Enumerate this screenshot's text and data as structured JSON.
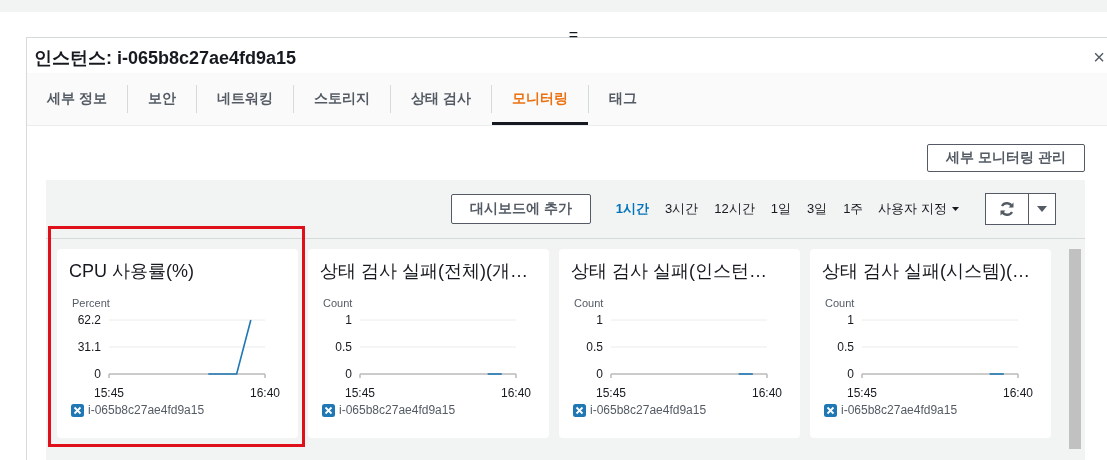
{
  "resize_handle": "=",
  "panel": {
    "title": "인스턴스: i-065b8c27ae4fd9a15",
    "close": "×"
  },
  "tabs": [
    {
      "label": "세부 정보",
      "selected": false
    },
    {
      "label": "보안",
      "selected": false
    },
    {
      "label": "네트워킹",
      "selected": false
    },
    {
      "label": "스토리지",
      "selected": false
    },
    {
      "label": "상태 검사",
      "selected": false
    },
    {
      "label": "모니터링",
      "selected": true
    },
    {
      "label": "태그",
      "selected": false
    }
  ],
  "manage_button": "세부 모니터링 관리",
  "toolbar": {
    "add_button": "대시보드에 추가",
    "time_ranges": [
      {
        "label": "1시간",
        "selected": true
      },
      {
        "label": "3시간",
        "selected": false
      },
      {
        "label": "12시간",
        "selected": false
      },
      {
        "label": "1일",
        "selected": false
      },
      {
        "label": "3일",
        "selected": false
      },
      {
        "label": "1주",
        "selected": false
      }
    ],
    "custom_range": "사용자 지정"
  },
  "charts": [
    {
      "highlighted": true,
      "chart_data": {
        "type": "line",
        "title": "CPU 사용률(%)",
        "ylabel": "Percent",
        "categories": [
          "15:45",
          null,
          null,
          null,
          null,
          null,
          null,
          null,
          null,
          null,
          null,
          "16:40"
        ],
        "series": [
          {
            "name": "i-065b8c27ae4fd9a15",
            "color": "#1f77b4",
            "values": [
              null,
              null,
              null,
              null,
              null,
              null,
              null,
              0,
              0,
              0,
              62.2,
              null
            ]
          }
        ],
        "ylim": [
          0,
          62.2
        ],
        "yticks": [
          0,
          31.1,
          62.2
        ]
      }
    },
    {
      "highlighted": false,
      "chart_data": {
        "type": "line",
        "title": "상태 검사 실패(전체)(개…",
        "ylabel": "Count",
        "categories": [
          "15:45",
          null,
          null,
          null,
          null,
          null,
          null,
          null,
          null,
          null,
          null,
          "16:40"
        ],
        "series": [
          {
            "name": "i-065b8c27ae4fd9a15",
            "color": "#1f77b4",
            "values": [
              null,
              null,
              null,
              null,
              null,
              null,
              null,
              null,
              null,
              0,
              0,
              null
            ]
          }
        ],
        "ylim": [
          0,
          1
        ],
        "yticks": [
          0,
          0.5,
          1
        ]
      }
    },
    {
      "highlighted": false,
      "chart_data": {
        "type": "line",
        "title": "상태 검사 실패(인스턴…",
        "ylabel": "Count",
        "categories": [
          "15:45",
          null,
          null,
          null,
          null,
          null,
          null,
          null,
          null,
          null,
          null,
          "16:40"
        ],
        "series": [
          {
            "name": "i-065b8c27ae4fd9a15",
            "color": "#1f77b4",
            "values": [
              null,
              null,
              null,
              null,
              null,
              null,
              null,
              null,
              null,
              0,
              0,
              null
            ]
          }
        ],
        "ylim": [
          0,
          1
        ],
        "yticks": [
          0,
          0.5,
          1
        ]
      }
    },
    {
      "highlighted": false,
      "chart_data": {
        "type": "line",
        "title": "상태 검사 실패(시스템)(…",
        "ylabel": "Count",
        "categories": [
          "15:45",
          null,
          null,
          null,
          null,
          null,
          null,
          null,
          null,
          null,
          null,
          "16:40"
        ],
        "series": [
          {
            "name": "i-065b8c27ae4fd9a15",
            "color": "#1f77b4",
            "values": [
              null,
              null,
              null,
              null,
              null,
              null,
              null,
              null,
              null,
              0,
              0,
              null
            ]
          }
        ],
        "ylim": [
          0,
          1
        ],
        "yticks": [
          0,
          0.5,
          1
        ]
      }
    }
  ]
}
